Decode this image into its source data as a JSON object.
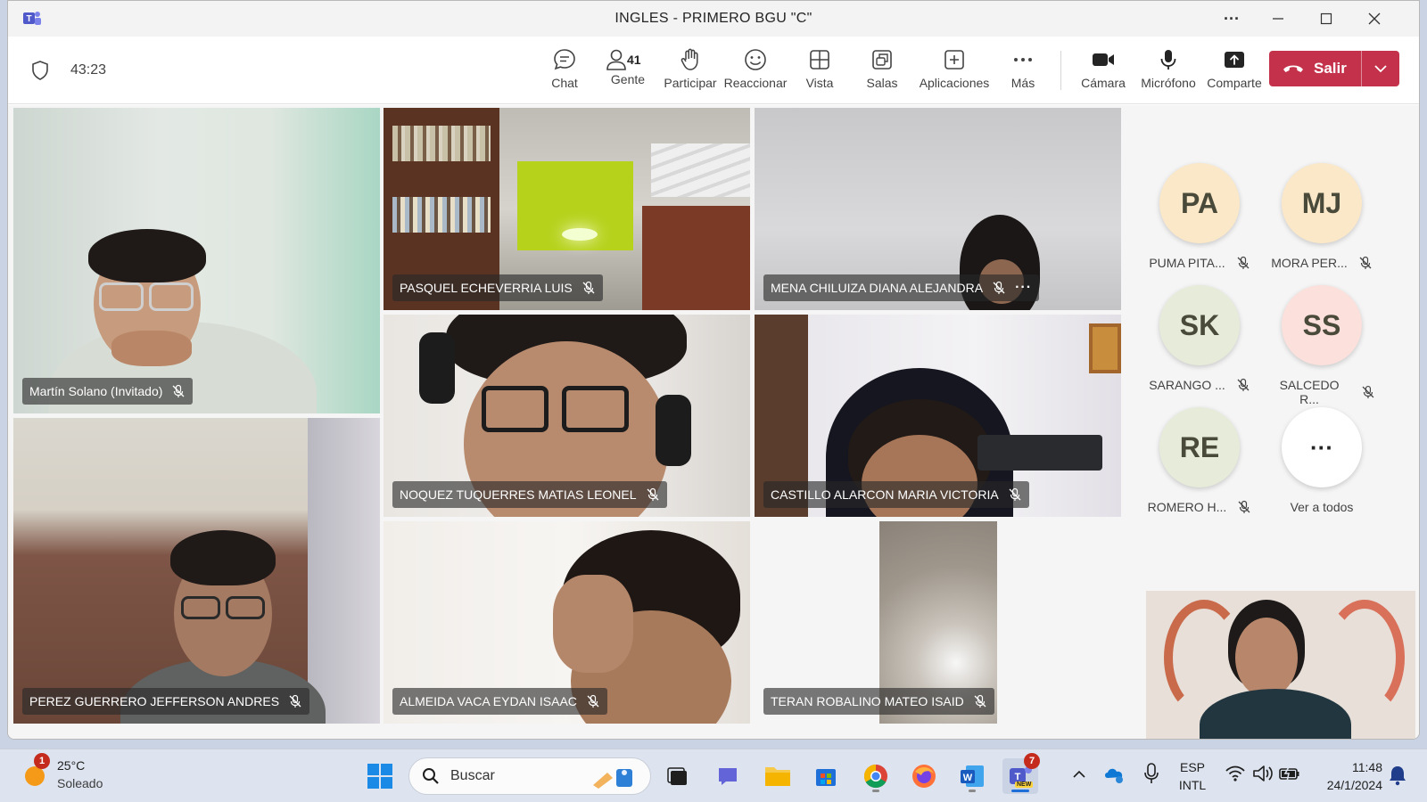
{
  "window": {
    "title": "INGLES - PRIMERO BGU \"C\"",
    "controls": {
      "more": "···",
      "minimize": "—",
      "maximize": "☐",
      "close": "✕"
    }
  },
  "toolbar": {
    "timer": "43:23",
    "buttons": [
      {
        "id": "chat",
        "label": "Chat",
        "icon": "chat-icon"
      },
      {
        "id": "people",
        "label": "Gente",
        "icon": "people-icon",
        "count": "41"
      },
      {
        "id": "raise",
        "label": "Participar",
        "icon": "raise-hand-icon"
      },
      {
        "id": "react",
        "label": "Reaccionar",
        "icon": "smiley-icon"
      },
      {
        "id": "view",
        "label": "Vista",
        "icon": "grid-view-icon"
      },
      {
        "id": "rooms",
        "label": "Salas",
        "icon": "breakout-rooms-icon"
      },
      {
        "id": "apps",
        "label": "Aplicaciones",
        "icon": "add-apps-icon"
      },
      {
        "id": "more",
        "label": "Más",
        "icon": "more-icon"
      },
      {
        "id": "camera",
        "label": "Cámara",
        "icon": "camera-icon"
      },
      {
        "id": "mic",
        "label": "Micrófono",
        "icon": "microphone-icon"
      },
      {
        "id": "share",
        "label": "Comparte",
        "icon": "share-icon"
      }
    ],
    "leave_label": "Salir",
    "leave_color": "#c4314b"
  },
  "video_tiles": [
    {
      "name": "Martín Solano (Invitado)",
      "muted": true
    },
    {
      "name": "PASQUEL ECHEVERRIA LUIS",
      "muted": true
    },
    {
      "name": "MENA CHILUIZA DIANA ALEJANDRA",
      "muted": true,
      "more": "···"
    },
    {
      "name": "NOQUEZ TUQUERRES MATIAS LEONEL",
      "muted": true
    },
    {
      "name": "CASTILLO ALARCON MARIA VICTORIA",
      "muted": true
    },
    {
      "name": "PEREZ GUERRERO JEFFERSON ANDRES",
      "muted": true
    },
    {
      "name": "ALMEIDA VACA EYDAN ISAAC",
      "muted": true
    },
    {
      "name": "TERAN ROBALINO MATEO ISAID",
      "muted": true
    }
  ],
  "roster": [
    {
      "initials": "PA",
      "name": "PUMA PITA...",
      "color": "#fbe8c8",
      "muted": true
    },
    {
      "initials": "MJ",
      "name": "MORA PER...",
      "color": "#fbe8c8",
      "muted": true
    },
    {
      "initials": "SK",
      "name": "SARANGO ...",
      "color": "#e6ecd9",
      "muted": true
    },
    {
      "initials": "SS",
      "name": "SALCEDO R...",
      "color": "#fbe0dc",
      "muted": true
    },
    {
      "initials": "RE",
      "name": "ROMERO H...",
      "color": "#e6ecd9",
      "muted": true
    },
    {
      "initials": "···",
      "name": "Ver a todos",
      "color": "#ffffff",
      "muted": false
    }
  ],
  "taskbar": {
    "weather": {
      "temp": "25°C",
      "condition": "Soleado",
      "badge": "1"
    },
    "search_placeholder": "Buscar",
    "teams_badge": "7",
    "teams_new": "NEW",
    "lang": "ESP",
    "layout": "INTL",
    "time": "11:48",
    "date": "24/1/2024"
  }
}
